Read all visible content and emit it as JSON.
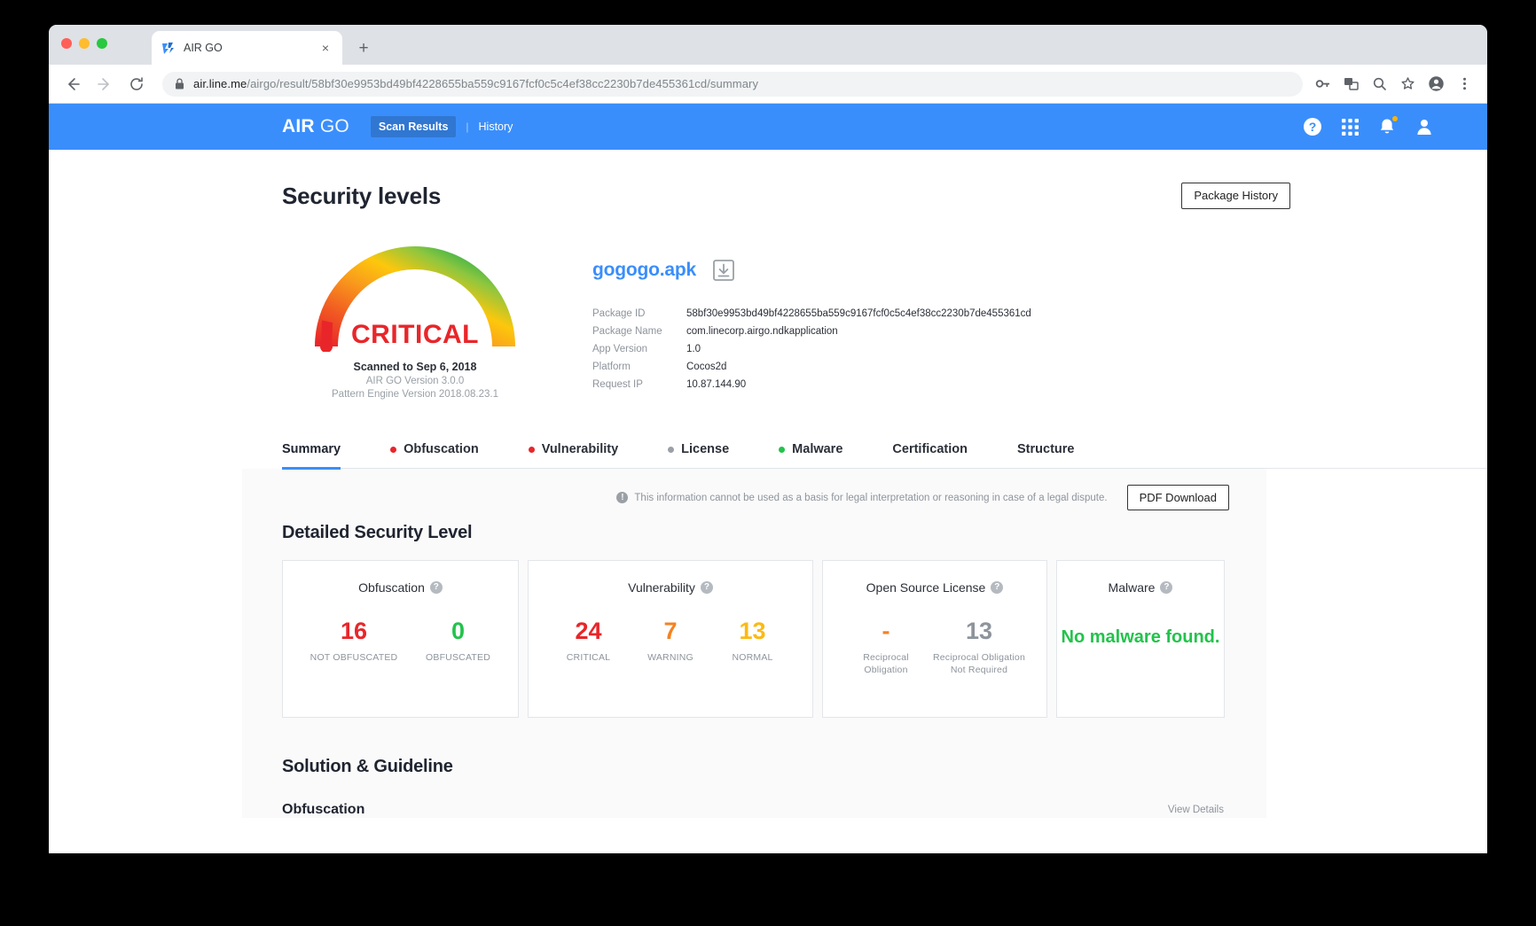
{
  "browser": {
    "tab_title": "AIR GO",
    "tab_favicon": "airgo-logo-icon",
    "close_label": "×",
    "newtab_label": "+",
    "url_host": "air.line.me",
    "url_path": "/airgo/result/58bf30e9953bd49bf4228655ba559c9167fcf0c5c4ef38cc2230b7de455361cd/summary",
    "toolbar_icons": [
      "back-arrow-icon",
      "forward-arrow-icon",
      "reload-icon",
      "lock-icon",
      "key-icon",
      "translate-icon",
      "zoom-out-icon",
      "bookmark-star-icon",
      "profile-avatar-icon",
      "chrome-menu-icon"
    ]
  },
  "appbar": {
    "brand_air": "AIR",
    "brand_go": "GO",
    "nav_scan_results": "Scan Results",
    "nav_separator": "|",
    "nav_history": "History",
    "icons": [
      "help-circle-icon",
      "apps-grid-icon",
      "notification-bell-icon",
      "user-account-icon"
    ],
    "bg_color": "#3a8efb"
  },
  "header": {
    "title": "Security levels",
    "package_history_button": "Package History"
  },
  "gauge": {
    "level": "CRITICAL",
    "level_color": "#e8262a",
    "scanned_to": "Scanned to Sep 6, 2018",
    "airgo_version": "AIR GO Version 3.0.0",
    "pattern_engine_version": "Pattern Engine Version 2018.08.23.1"
  },
  "package": {
    "file_name": "gogogo.apk",
    "download_icon": "download-box-icon",
    "fields": [
      {
        "key": "Package ID",
        "value": "58bf30e9953bd49bf4228655ba559c9167fcf0c5c4ef38cc2230b7de455361cd"
      },
      {
        "key": "Package Name",
        "value": "com.linecorp.airgo.ndkapplication"
      },
      {
        "key": "App Version",
        "value": "1.0"
      },
      {
        "key": "Platform",
        "value": "Cocos2d"
      },
      {
        "key": "Request IP",
        "value": "10.87.144.90"
      }
    ]
  },
  "tabs": [
    {
      "label": "Summary",
      "dot": null,
      "active": true
    },
    {
      "label": "Obfuscation",
      "dot": "#e8262a",
      "active": false
    },
    {
      "label": "Vulnerability",
      "dot": "#e8262a",
      "active": false
    },
    {
      "label": "License",
      "dot": "#9aa0a6",
      "active": false
    },
    {
      "label": "Malware",
      "dot": "#22c34b",
      "active": false
    },
    {
      "label": "Certification",
      "dot": null,
      "active": false
    },
    {
      "label": "Structure",
      "dot": null,
      "active": false
    }
  ],
  "panel": {
    "notice_icon": "info-icon",
    "notice_text": "This information cannot be used as a basis for legal interpretation or reasoning in case of a legal dispute.",
    "pdf_button": "PDF Download",
    "detailed_title": "Detailed Security Level",
    "solution_title": "Solution & Guideline",
    "cut_section_title": "Obfuscation",
    "cut_section_link": "View Details"
  },
  "cards": [
    {
      "title": "Obfuscation",
      "help_icon": "help-circle-icon",
      "metrics": [
        {
          "num": "16",
          "cap": "NOT OBFUSCATED",
          "color": "#e8262a"
        },
        {
          "num": "0",
          "cap": "OBFUSCATED",
          "color": "#22c34b"
        }
      ]
    },
    {
      "title": "Vulnerability",
      "help_icon": "help-circle-icon",
      "metrics": [
        {
          "num": "24",
          "cap": "CRITICAL",
          "color": "#e8262a"
        },
        {
          "num": "7",
          "cap": "WARNING",
          "color": "#f58220"
        },
        {
          "num": "13",
          "cap": "NORMAL",
          "color": "#fdb913"
        }
      ]
    },
    {
      "title": "Open Source License",
      "help_icon": "help-circle-icon",
      "metrics": [
        {
          "num": "-",
          "cap": "Reciprocal Obligation",
          "color": "#f58220"
        },
        {
          "num": "13",
          "cap": "Reciprocal Obligation Not Required",
          "color": "#8e949c"
        }
      ]
    },
    {
      "title": "Malware",
      "help_icon": "help-circle-icon",
      "message": "No malware found.",
      "message_color": "#22c34b"
    }
  ]
}
